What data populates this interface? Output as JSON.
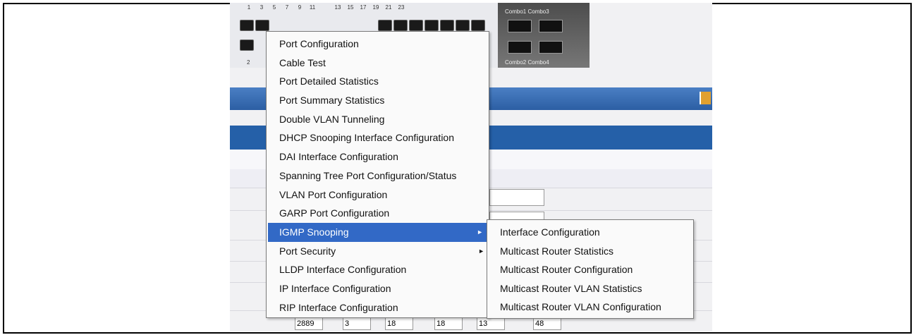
{
  "device": {
    "top_port_numbers": [
      "1",
      "3",
      "5",
      "7",
      "9",
      "11",
      "",
      "13",
      "15",
      "17",
      "19",
      "21",
      "23"
    ],
    "bottom_port_number": "2",
    "combo_top_label": "Combo1 Combo3",
    "combo_bottom_label": "Combo2 Combo4"
  },
  "ip_fields": [
    "2889",
    "3",
    "18",
    "18",
    "13",
    "48"
  ],
  "context_menu": {
    "items": [
      {
        "label": "Port Configuration",
        "submenu": false
      },
      {
        "label": "Cable Test",
        "submenu": false
      },
      {
        "label": "Port Detailed Statistics",
        "submenu": false
      },
      {
        "label": "Port Summary Statistics",
        "submenu": false
      },
      {
        "label": "Double VLAN Tunneling",
        "submenu": false
      },
      {
        "label": "DHCP Snooping Interface Configuration",
        "submenu": false
      },
      {
        "label": "DAI Interface Configuration",
        "submenu": false
      },
      {
        "label": "Spanning Tree Port Configuration/Status",
        "submenu": false
      },
      {
        "label": "VLAN Port Configuration",
        "submenu": false
      },
      {
        "label": "GARP Port Configuration",
        "submenu": false
      },
      {
        "label": "IGMP Snooping",
        "submenu": true,
        "active": true
      },
      {
        "label": "Port Security",
        "submenu": true
      },
      {
        "label": "LLDP Interface Configuration",
        "submenu": false
      },
      {
        "label": "IP Interface Configuration",
        "submenu": false
      },
      {
        "label": "RIP Interface Configuration",
        "submenu": false
      }
    ],
    "submenu_arrow": "►"
  },
  "igmp_submenu": {
    "items": [
      "Interface Configuration",
      "Multicast Router Statistics",
      "Multicast Router Configuration",
      "Multicast Router VLAN Statistics",
      "Multicast Router VLAN Configuration"
    ]
  },
  "colors": {
    "menu_highlight": "#3269c6",
    "header_bar": "#2b62a8"
  }
}
